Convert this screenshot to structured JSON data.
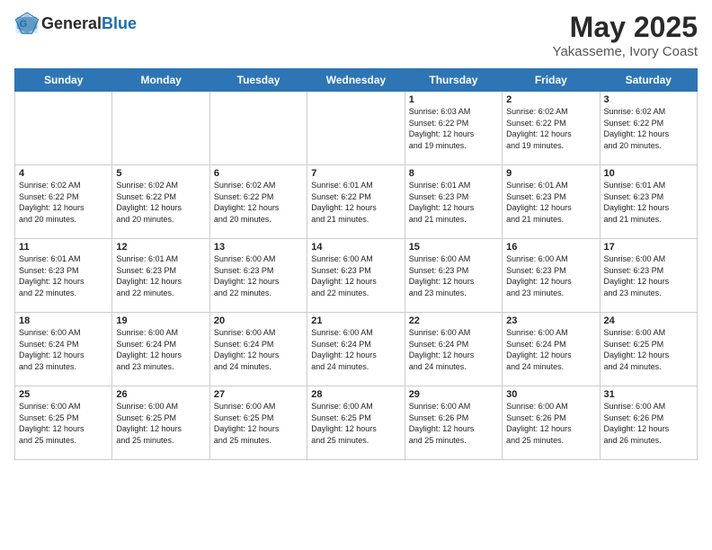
{
  "header": {
    "logo_general": "General",
    "logo_blue": "Blue",
    "title": "May 2025",
    "subtitle": "Yakasseme, Ivory Coast"
  },
  "calendar": {
    "days_of_week": [
      "Sunday",
      "Monday",
      "Tuesday",
      "Wednesday",
      "Thursday",
      "Friday",
      "Saturday"
    ],
    "weeks": [
      [
        {
          "day": "",
          "info": "",
          "empty": true
        },
        {
          "day": "",
          "info": "",
          "empty": true
        },
        {
          "day": "",
          "info": "",
          "empty": true
        },
        {
          "day": "",
          "info": "",
          "empty": true
        },
        {
          "day": "1",
          "info": "Sunrise: 6:03 AM\nSunset: 6:22 PM\nDaylight: 12 hours\nand 19 minutes.",
          "empty": false
        },
        {
          "day": "2",
          "info": "Sunrise: 6:02 AM\nSunset: 6:22 PM\nDaylight: 12 hours\nand 19 minutes.",
          "empty": false
        },
        {
          "day": "3",
          "info": "Sunrise: 6:02 AM\nSunset: 6:22 PM\nDaylight: 12 hours\nand 20 minutes.",
          "empty": false
        }
      ],
      [
        {
          "day": "4",
          "info": "Sunrise: 6:02 AM\nSunset: 6:22 PM\nDaylight: 12 hours\nand 20 minutes.",
          "empty": false
        },
        {
          "day": "5",
          "info": "Sunrise: 6:02 AM\nSunset: 6:22 PM\nDaylight: 12 hours\nand 20 minutes.",
          "empty": false
        },
        {
          "day": "6",
          "info": "Sunrise: 6:02 AM\nSunset: 6:22 PM\nDaylight: 12 hours\nand 20 minutes.",
          "empty": false
        },
        {
          "day": "7",
          "info": "Sunrise: 6:01 AM\nSunset: 6:22 PM\nDaylight: 12 hours\nand 21 minutes.",
          "empty": false
        },
        {
          "day": "8",
          "info": "Sunrise: 6:01 AM\nSunset: 6:23 PM\nDaylight: 12 hours\nand 21 minutes.",
          "empty": false
        },
        {
          "day": "9",
          "info": "Sunrise: 6:01 AM\nSunset: 6:23 PM\nDaylight: 12 hours\nand 21 minutes.",
          "empty": false
        },
        {
          "day": "10",
          "info": "Sunrise: 6:01 AM\nSunset: 6:23 PM\nDaylight: 12 hours\nand 21 minutes.",
          "empty": false
        }
      ],
      [
        {
          "day": "11",
          "info": "Sunrise: 6:01 AM\nSunset: 6:23 PM\nDaylight: 12 hours\nand 22 minutes.",
          "empty": false
        },
        {
          "day": "12",
          "info": "Sunrise: 6:01 AM\nSunset: 6:23 PM\nDaylight: 12 hours\nand 22 minutes.",
          "empty": false
        },
        {
          "day": "13",
          "info": "Sunrise: 6:00 AM\nSunset: 6:23 PM\nDaylight: 12 hours\nand 22 minutes.",
          "empty": false
        },
        {
          "day": "14",
          "info": "Sunrise: 6:00 AM\nSunset: 6:23 PM\nDaylight: 12 hours\nand 22 minutes.",
          "empty": false
        },
        {
          "day": "15",
          "info": "Sunrise: 6:00 AM\nSunset: 6:23 PM\nDaylight: 12 hours\nand 23 minutes.",
          "empty": false
        },
        {
          "day": "16",
          "info": "Sunrise: 6:00 AM\nSunset: 6:23 PM\nDaylight: 12 hours\nand 23 minutes.",
          "empty": false
        },
        {
          "day": "17",
          "info": "Sunrise: 6:00 AM\nSunset: 6:23 PM\nDaylight: 12 hours\nand 23 minutes.",
          "empty": false
        }
      ],
      [
        {
          "day": "18",
          "info": "Sunrise: 6:00 AM\nSunset: 6:24 PM\nDaylight: 12 hours\nand 23 minutes.",
          "empty": false
        },
        {
          "day": "19",
          "info": "Sunrise: 6:00 AM\nSunset: 6:24 PM\nDaylight: 12 hours\nand 23 minutes.",
          "empty": false
        },
        {
          "day": "20",
          "info": "Sunrise: 6:00 AM\nSunset: 6:24 PM\nDaylight: 12 hours\nand 24 minutes.",
          "empty": false
        },
        {
          "day": "21",
          "info": "Sunrise: 6:00 AM\nSunset: 6:24 PM\nDaylight: 12 hours\nand 24 minutes.",
          "empty": false
        },
        {
          "day": "22",
          "info": "Sunrise: 6:00 AM\nSunset: 6:24 PM\nDaylight: 12 hours\nand 24 minutes.",
          "empty": false
        },
        {
          "day": "23",
          "info": "Sunrise: 6:00 AM\nSunset: 6:24 PM\nDaylight: 12 hours\nand 24 minutes.",
          "empty": false
        },
        {
          "day": "24",
          "info": "Sunrise: 6:00 AM\nSunset: 6:25 PM\nDaylight: 12 hours\nand 24 minutes.",
          "empty": false
        }
      ],
      [
        {
          "day": "25",
          "info": "Sunrise: 6:00 AM\nSunset: 6:25 PM\nDaylight: 12 hours\nand 25 minutes.",
          "empty": false
        },
        {
          "day": "26",
          "info": "Sunrise: 6:00 AM\nSunset: 6:25 PM\nDaylight: 12 hours\nand 25 minutes.",
          "empty": false
        },
        {
          "day": "27",
          "info": "Sunrise: 6:00 AM\nSunset: 6:25 PM\nDaylight: 12 hours\nand 25 minutes.",
          "empty": false
        },
        {
          "day": "28",
          "info": "Sunrise: 6:00 AM\nSunset: 6:25 PM\nDaylight: 12 hours\nand 25 minutes.",
          "empty": false
        },
        {
          "day": "29",
          "info": "Sunrise: 6:00 AM\nSunset: 6:26 PM\nDaylight: 12 hours\nand 25 minutes.",
          "empty": false
        },
        {
          "day": "30",
          "info": "Sunrise: 6:00 AM\nSunset: 6:26 PM\nDaylight: 12 hours\nand 25 minutes.",
          "empty": false
        },
        {
          "day": "31",
          "info": "Sunrise: 6:00 AM\nSunset: 6:26 PM\nDaylight: 12 hours\nand 26 minutes.",
          "empty": false
        }
      ]
    ]
  }
}
